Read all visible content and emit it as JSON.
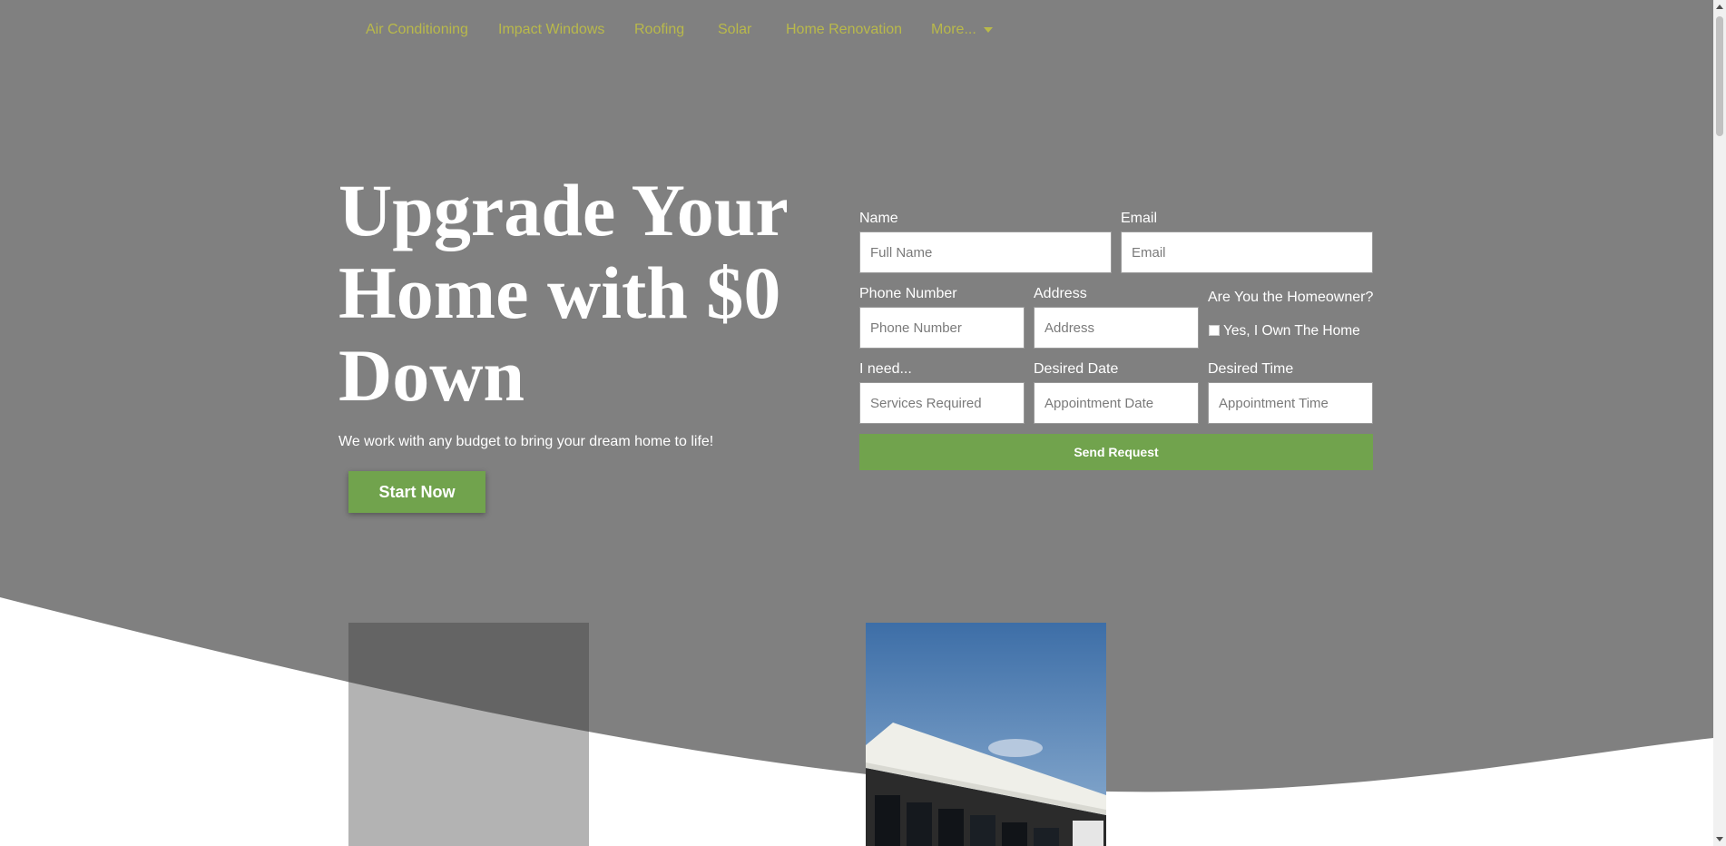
{
  "nav": {
    "items": [
      {
        "label": "Air Conditioning"
      },
      {
        "label": "Impact Windows"
      },
      {
        "label": "Roofing"
      },
      {
        "label": "Solar"
      },
      {
        "label": "Home Renovation"
      },
      {
        "label": "More..."
      }
    ]
  },
  "hero": {
    "headline": "Upgrade Your Home with $0 Down",
    "subtitle": "We work with any budget to bring your dream home to life!",
    "cta_label": "Start Now"
  },
  "form": {
    "name_label": "Name",
    "name_placeholder": "Full Name",
    "email_label": "Email",
    "email_placeholder": "Email",
    "phone_label": "Phone Number",
    "phone_placeholder": "Phone Number",
    "address_label": "Address",
    "address_placeholder": "Address",
    "homeowner_label": "Are You the Homeowner?",
    "homeowner_option": "Yes, I Own The Home",
    "need_label": "I need...",
    "need_placeholder": "Services Required",
    "date_label": "Desired Date",
    "date_placeholder": "Appointment Date",
    "time_label": "Desired Time",
    "time_placeholder": "Appointment Time",
    "submit_label": "Send Request"
  },
  "colors": {
    "hero_background": "#808080",
    "nav_link": "#b9b94a",
    "accent_green": "#71a34d",
    "page_background": "#ffffff"
  }
}
